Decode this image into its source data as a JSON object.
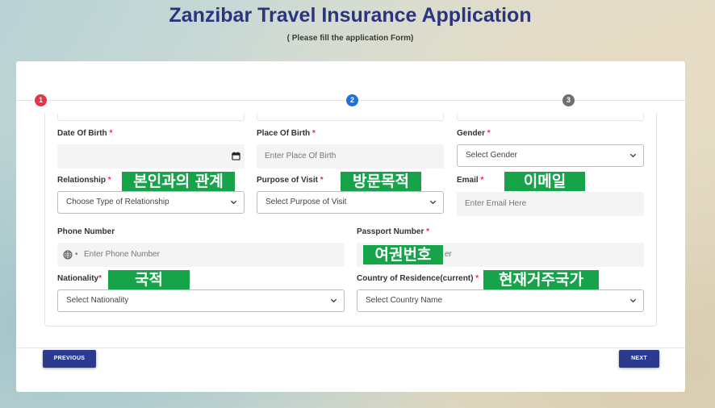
{
  "header": {
    "title": "Zanzibar Travel Insurance Application",
    "subtitle": "( Please fill the application Form)"
  },
  "steps": [
    {
      "number": "1",
      "color": "#e8324a"
    },
    {
      "number": "2",
      "color": "#1f6fe0"
    },
    {
      "number": "3",
      "color": "#6f6f6f"
    }
  ],
  "form": {
    "dob": {
      "label": "Date Of Birth",
      "required": "*",
      "value": ""
    },
    "place_of_birth": {
      "label": "Place Of Birth",
      "required": "*",
      "placeholder": "Enter Place Of Birth"
    },
    "gender": {
      "label": "Gender",
      "required": "*",
      "value": "Select Gender"
    },
    "relationship": {
      "label": "Relationship",
      "required": "*",
      "value": "Choose Type of Relationship"
    },
    "purpose": {
      "label": "Purpose of Visit",
      "required": "*",
      "value": "Select Purpose of Visit"
    },
    "email": {
      "label": "Email",
      "required": "*",
      "placeholder": "Enter Email Here"
    },
    "phone": {
      "label": "Phone Number",
      "placeholder": "Enter Phone Number",
      "country_sep": "•"
    },
    "passport": {
      "label": "Passport Number",
      "required": "*",
      "placeholder_tail": "er"
    },
    "nationality": {
      "label": "Nationality",
      "required": "*",
      "value": "Select Nationality"
    },
    "residence": {
      "label": "Country of Residence(current)",
      "required": "*",
      "value": "Select Country Name"
    }
  },
  "annotations": {
    "relationship": "본인과의 관계",
    "purpose": "방문목적",
    "email": "이메일",
    "passport": "여권번호",
    "nationality": "국적",
    "residence": "현재거주국가"
  },
  "buttons": {
    "previous": "PREVIOUS",
    "next": "NEXT"
  },
  "colors": {
    "title": "#2b347f",
    "button": "#2b3a8f",
    "annotation": "#16a34a",
    "required": "#e0334c"
  }
}
